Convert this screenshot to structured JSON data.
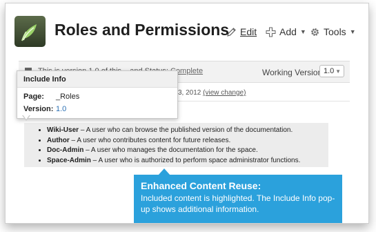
{
  "page": {
    "title": "Roles and Permissions"
  },
  "toolbar": {
    "edit": "Edit",
    "add": "Add",
    "tools": "Tools"
  },
  "statusbar": {
    "text_before": "This is version 1.0 of this ...and Status: ",
    "status_link": "Complete",
    "working_version_label": "Working Version:",
    "working_version_value": "1.0"
  },
  "modification": {
    "date_text": "3, 2012",
    "change_link": "(view change)"
  },
  "popup": {
    "title": "Include Info",
    "page_label": "Page:",
    "page_value": "_Roles",
    "version_label": "Version:",
    "version_value": "1.0"
  },
  "roles": [
    {
      "name": "Wiki-User",
      "desc": " – A user who can browse the published version of the documentation."
    },
    {
      "name": "Author",
      "desc": " – A user who contributes content for future releases."
    },
    {
      "name": "Doc-Admin",
      "desc": " – A user who manages the documentation for the space."
    },
    {
      "name": "Space-Admin",
      "desc": " – A user who is authorized to perform space administrator functions."
    }
  ],
  "callout": {
    "title": "Enhanced Content Reuse:",
    "body": "Included content is highlighted. The Include Info pop-up shows additional information."
  },
  "colors": {
    "callout_bg": "#2ba1dc",
    "link": "#2a6fb3"
  },
  "icons": [
    "leaf-logo-icon",
    "pencil-icon",
    "plus-icon",
    "gear-icon",
    "document-icon"
  ]
}
